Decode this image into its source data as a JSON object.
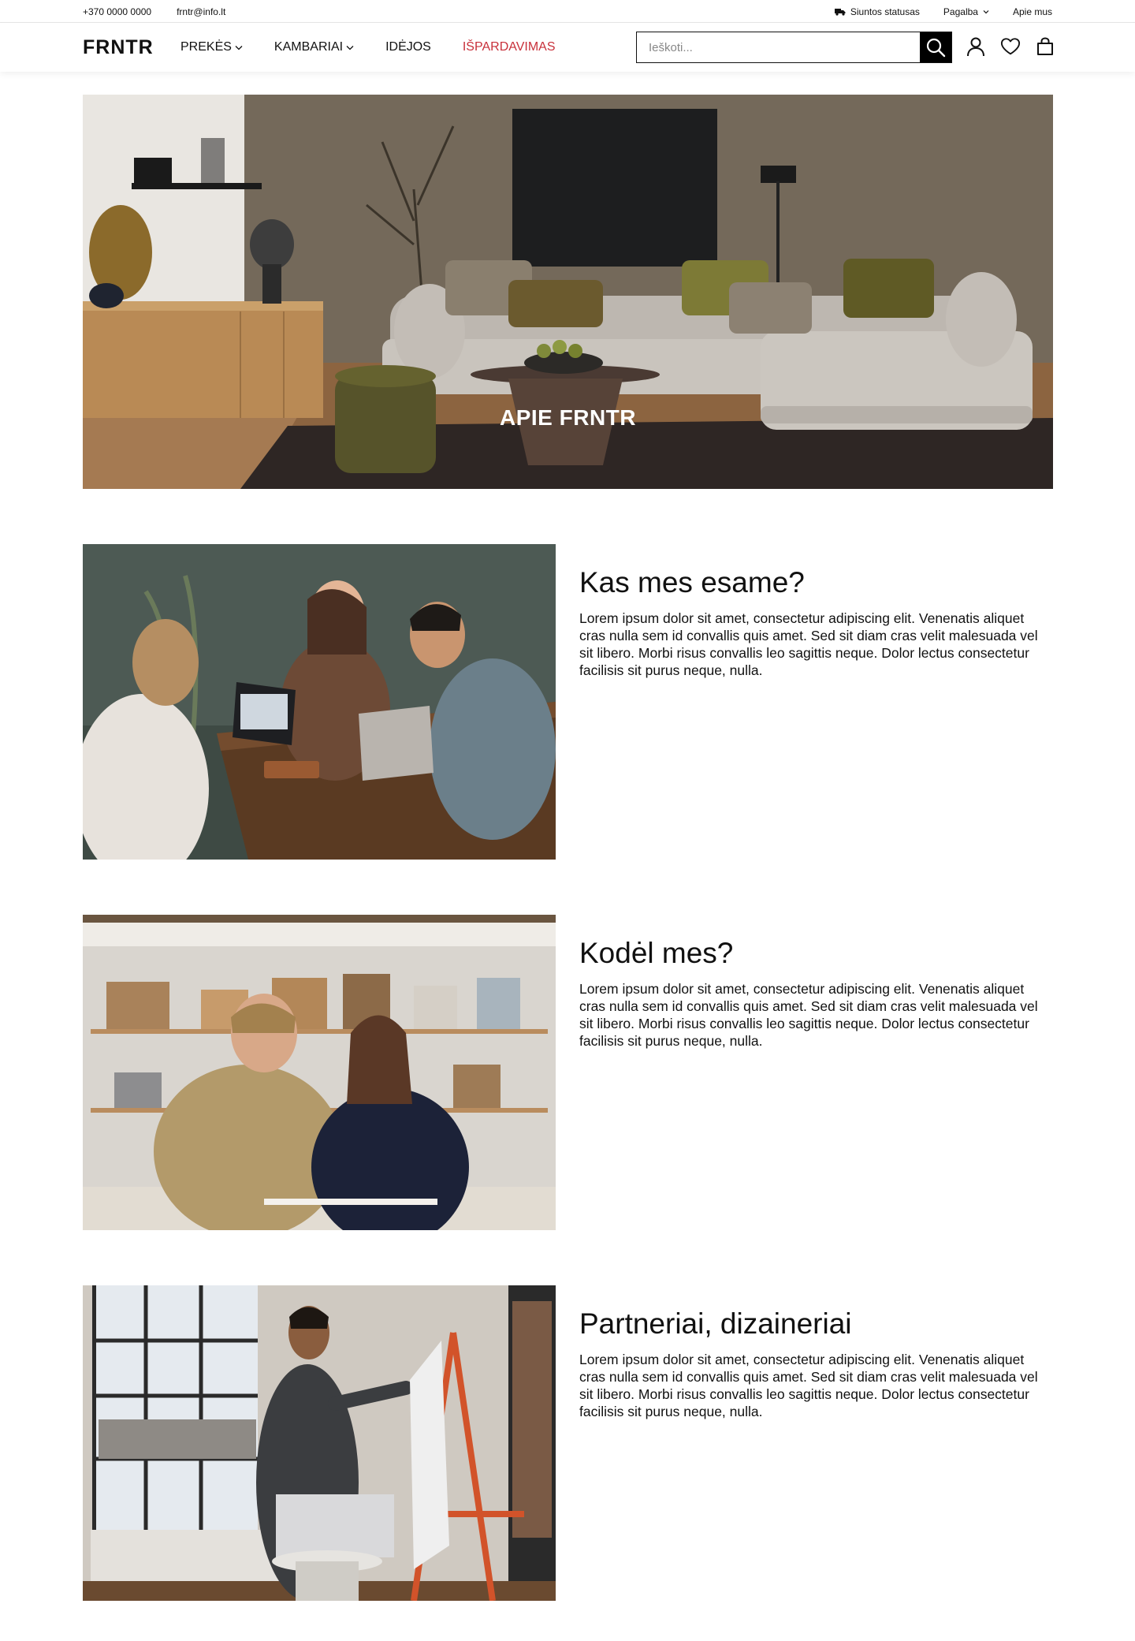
{
  "topbar": {
    "phone": "+370 0000 0000",
    "email": "frntr@info.lt",
    "shipping_status": "Siuntos statusas",
    "help": "Pagalba",
    "about": "Apie mus"
  },
  "header": {
    "logo": "FRNTR",
    "nav": [
      {
        "label": "PREKĖS",
        "has_dropdown": true
      },
      {
        "label": "KAMBARIAI",
        "has_dropdown": true
      },
      {
        "label": "IDĖJOS",
        "has_dropdown": false
      },
      {
        "label": "IŠPARDAVIMAS",
        "has_dropdown": false
      }
    ],
    "search_placeholder": "Ieškoti...",
    "icons": [
      "search-icon",
      "user-icon",
      "heart-icon",
      "bag-icon"
    ],
    "sale_color": "#c8303a"
  },
  "hero": {
    "title": "APIE FRNTR"
  },
  "sections": [
    {
      "heading": "Kas mes esame?",
      "body": "Lorem ipsum dolor sit amet, consectetur adipiscing elit. Venenatis aliquet cras nulla sem id convallis quis amet. Sed sit diam cras velit malesuada vel sit libero. Morbi risus convallis leo sagittis neque. Dolor lectus consectetur facilisis sit purus neque, nulla."
    },
    {
      "heading": "Kodėl mes?",
      "body": "Lorem ipsum dolor sit amet, consectetur adipiscing elit. Venenatis aliquet cras nulla sem id convallis quis amet. Sed sit diam cras velit malesuada vel sit libero. Morbi risus convallis leo sagittis neque. Dolor lectus consectetur facilisis sit purus neque, nulla."
    },
    {
      "heading": "Partneriai, dizaineriai",
      "body": "Lorem ipsum dolor sit amet, consectetur adipiscing elit. Venenatis aliquet cras nulla sem id convallis quis amet. Sed sit diam cras velit malesuada vel sit libero. Morbi risus convallis leo sagittis neque. Dolor lectus consectetur facilisis sit purus neque, nulla."
    }
  ]
}
